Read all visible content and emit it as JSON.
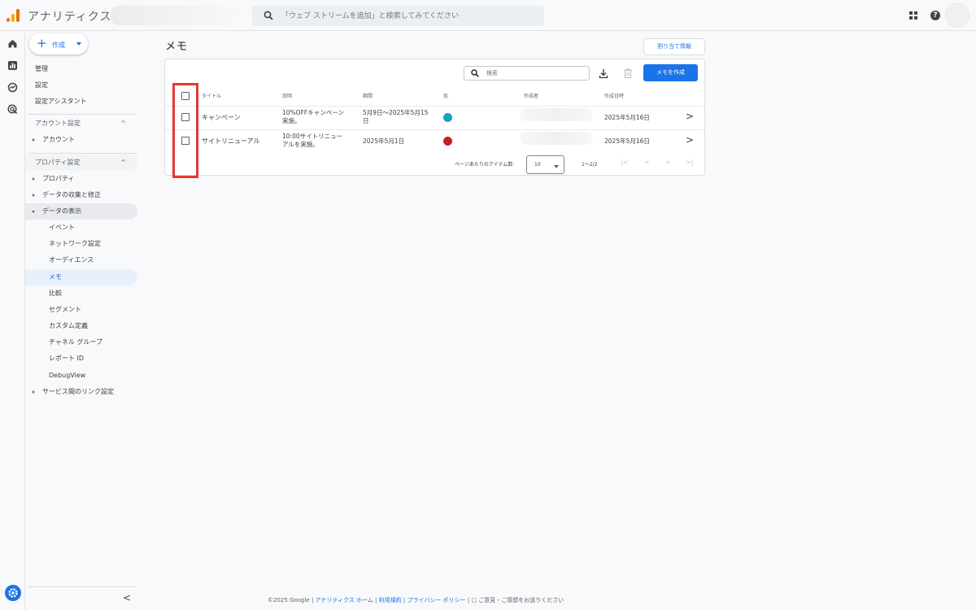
{
  "header": {
    "app_title": "アナリティクス",
    "search_placeholder": "「ウェブ ストリームを追加」と検索してみてください",
    "help_glyph": "?"
  },
  "sidenav": {
    "create_label": "作成",
    "items": [
      {
        "label": "管理"
      },
      {
        "label": "設定"
      },
      {
        "label": "設定アシスタント"
      }
    ],
    "account_section": {
      "label": "アカウント設定",
      "items": [
        {
          "label": "アカウント"
        }
      ]
    },
    "property_section": {
      "label": "プロパティ設定",
      "items": [
        {
          "label": "プロパティ"
        },
        {
          "label": "データの収集と修正"
        },
        {
          "label": "データの表示"
        }
      ],
      "data_display_children": [
        {
          "label": "イベント"
        },
        {
          "label": "ネットワーク設定"
        },
        {
          "label": "オーディエンス"
        },
        {
          "label": "メモ"
        },
        {
          "label": "比較"
        },
        {
          "label": "セグメント"
        },
        {
          "label": "カスタム定義"
        },
        {
          "label": "チャネル グループ"
        },
        {
          "label": "レポート ID"
        },
        {
          "label": "DebugView"
        }
      ],
      "service_links": {
        "label": "サービス間のリンク設定"
      }
    },
    "chevron_up": "^",
    "collapse_glyph": "<"
  },
  "main": {
    "page_title": "メモ",
    "info_button": "割り当て情報",
    "table": {
      "search_placeholder": "検索",
      "create_button": "メモを作成",
      "columns": [
        "タイトル",
        "説明",
        "期間",
        "色",
        "作成者",
        "作成日時"
      ],
      "rows": [
        {
          "title": "キャンペーン",
          "description_line1": "10%OFFキャンペーン",
          "description_line2": "実施。",
          "period_line1": "5月9日～2025年5月15",
          "period_line2": "日",
          "color": "#1aa0c4",
          "created": "2025年5月16日"
        },
        {
          "title": "サイトリニューアル",
          "description_line1": "10:00サイトリニュー",
          "description_line2": "アルを実施。",
          "period_line1": "2025年5月1日",
          "period_line2": "",
          "color": "#c5221f",
          "created": "2025年5月16日"
        }
      ],
      "row_chevron": ">",
      "pager": {
        "items_per_page_label": "ページあたりのアイテム数:",
        "items_per_page": "10",
        "range": "1～2/2",
        "first": "|<",
        "prev": "<",
        "next": ">",
        "last": ">|"
      }
    }
  },
  "footer": {
    "copyright": "©2025 Google |",
    "link_home": "アナリティクス ホーム",
    "sep1": "|",
    "link_terms": "利用規約",
    "sep2": "|",
    "link_privacy": "プライバシー ポリシー",
    "sep3": "|",
    "feedback": "ご意見・ご感想をお送りください"
  },
  "colors": {
    "accent": "#1a73e8",
    "highlight": "#e53935",
    "logo_orange": "#e37400",
    "logo_yellow": "#f9ab00"
  }
}
